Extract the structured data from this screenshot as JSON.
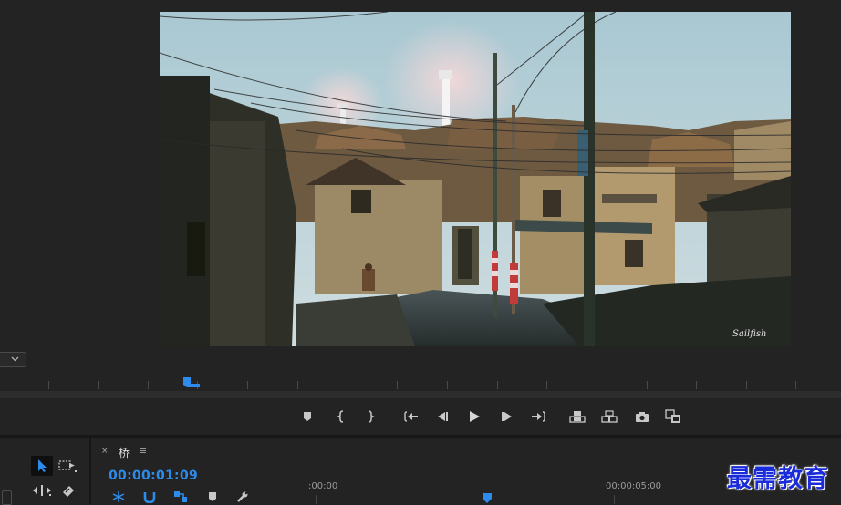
{
  "program_monitor": {
    "video_signature": "Sailfish",
    "zoom_dropdown_icon": "chevron-down-icon"
  },
  "transport_controls": [
    {
      "name": "add-marker",
      "icon": "marker-icon"
    },
    {
      "name": "mark-in",
      "icon": "mark-in-icon"
    },
    {
      "name": "mark-out",
      "icon": "mark-out-icon"
    },
    {
      "name": "go-to-in",
      "icon": "go-to-in-icon"
    },
    {
      "name": "step-back",
      "icon": "step-back-icon"
    },
    {
      "name": "play",
      "icon": "play-icon"
    },
    {
      "name": "step-forward",
      "icon": "step-forward-icon"
    },
    {
      "name": "go-to-out",
      "icon": "go-to-out-icon"
    },
    {
      "name": "lift",
      "icon": "lift-icon"
    },
    {
      "name": "extract",
      "icon": "extract-icon"
    },
    {
      "name": "export-frame",
      "icon": "camera-icon"
    },
    {
      "name": "comparison-view",
      "icon": "comparison-view-icon"
    }
  ],
  "tools": [
    {
      "name": "selection-tool",
      "icon": "arrow-icon",
      "active": true
    },
    {
      "name": "track-select-tool",
      "icon": "track-select-icon",
      "active": false
    },
    {
      "name": "ripple-edit-tool",
      "icon": "ripple-edit-icon",
      "active": false
    },
    {
      "name": "razor-tool",
      "icon": "razor-icon",
      "active": false
    }
  ],
  "timeline": {
    "tab_close": "×",
    "sequence_name": "桥",
    "menu_glyph": "≡",
    "timecode": "00:00:01:09",
    "ruler_labels": [
      ":00:00",
      "00:00:05:00"
    ],
    "tool_icons": [
      "snap-icon",
      "magnet-icon",
      "linked-selection-icon",
      "marker-icon",
      "wrench-icon"
    ]
  },
  "watermark": "最需教育",
  "colors": {
    "accent_blue": "#2d8ceb",
    "panel_bg": "#232323",
    "watermark_blue": "#1a2bd9"
  }
}
